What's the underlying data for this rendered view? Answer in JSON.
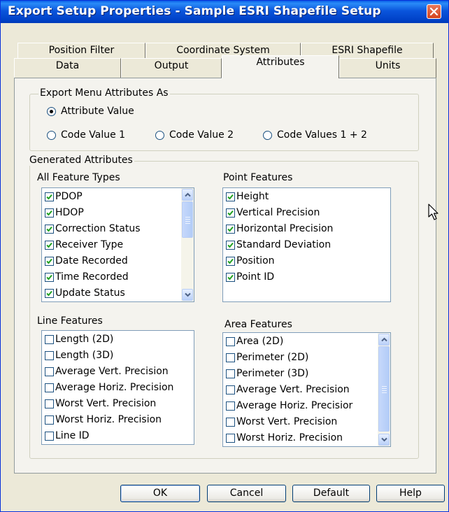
{
  "window": {
    "title": "Export Setup Properties - Sample ESRI Shapefile Setup"
  },
  "tabs": {
    "row_back": [
      "Position Filter",
      "Coordinate System",
      "ESRI Shapefile"
    ],
    "row_front": [
      "Data",
      "Output",
      "Attributes",
      "Units"
    ],
    "active": "Attributes"
  },
  "export_menu": {
    "title": "Export Menu Attributes As",
    "options": [
      "Attribute Value",
      "Code Value 1",
      "Code Value 2",
      "Code Values 1 + 2"
    ],
    "selected": "Attribute Value"
  },
  "generated": {
    "title": "Generated Attributes",
    "all_feature_types": {
      "label": "All Feature Types",
      "items": [
        {
          "label": "PDOP",
          "checked": true
        },
        {
          "label": "HDOP",
          "checked": true
        },
        {
          "label": "Correction Status",
          "checked": true
        },
        {
          "label": "Receiver Type",
          "checked": true
        },
        {
          "label": "Date Recorded",
          "checked": true
        },
        {
          "label": "Time Recorded",
          "checked": true
        },
        {
          "label": "Update Status",
          "checked": true
        }
      ]
    },
    "point_features": {
      "label": "Point Features",
      "items": [
        {
          "label": "Height",
          "checked": true
        },
        {
          "label": "Vertical Precision",
          "checked": true
        },
        {
          "label": "Horizontal Precision",
          "checked": true
        },
        {
          "label": "Standard Deviation",
          "checked": true
        },
        {
          "label": "Position",
          "checked": true
        },
        {
          "label": "Point ID",
          "checked": true
        }
      ]
    },
    "line_features": {
      "label": "Line Features",
      "items": [
        {
          "label": "Length (2D)",
          "checked": false
        },
        {
          "label": "Length (3D)",
          "checked": false
        },
        {
          "label": "Average Vert. Precision",
          "checked": false
        },
        {
          "label": "Average Horiz. Precision",
          "checked": false
        },
        {
          "label": "Worst Vert. Precision",
          "checked": false
        },
        {
          "label": "Worst Horiz. Precision",
          "checked": false
        },
        {
          "label": "Line ID",
          "checked": false
        }
      ]
    },
    "area_features": {
      "label": "Area Features",
      "items": [
        {
          "label": "Area (2D)",
          "checked": false
        },
        {
          "label": "Perimeter (2D)",
          "checked": false
        },
        {
          "label": "Perimeter (3D)",
          "checked": false
        },
        {
          "label": "Average Vert. Precision",
          "checked": false
        },
        {
          "label": "Average Horiz. Precisior",
          "checked": false
        },
        {
          "label": "Worst Vert. Precision",
          "checked": false
        },
        {
          "label": "Worst Horiz. Precision",
          "checked": false
        }
      ]
    }
  },
  "buttons": {
    "ok": "OK",
    "cancel": "Cancel",
    "default": "Default",
    "help": "Help"
  },
  "colors": {
    "titlebar": "#0a55dc",
    "close": "#d5441d",
    "dialog_bg": "#ece9d8",
    "panel_bg": "#f4f3ee"
  },
  "icons": {
    "close": "close-icon",
    "scroll_up": "arrow-up-icon",
    "scroll_down": "arrow-down-icon",
    "cursor": "mouse-pointer-icon"
  }
}
